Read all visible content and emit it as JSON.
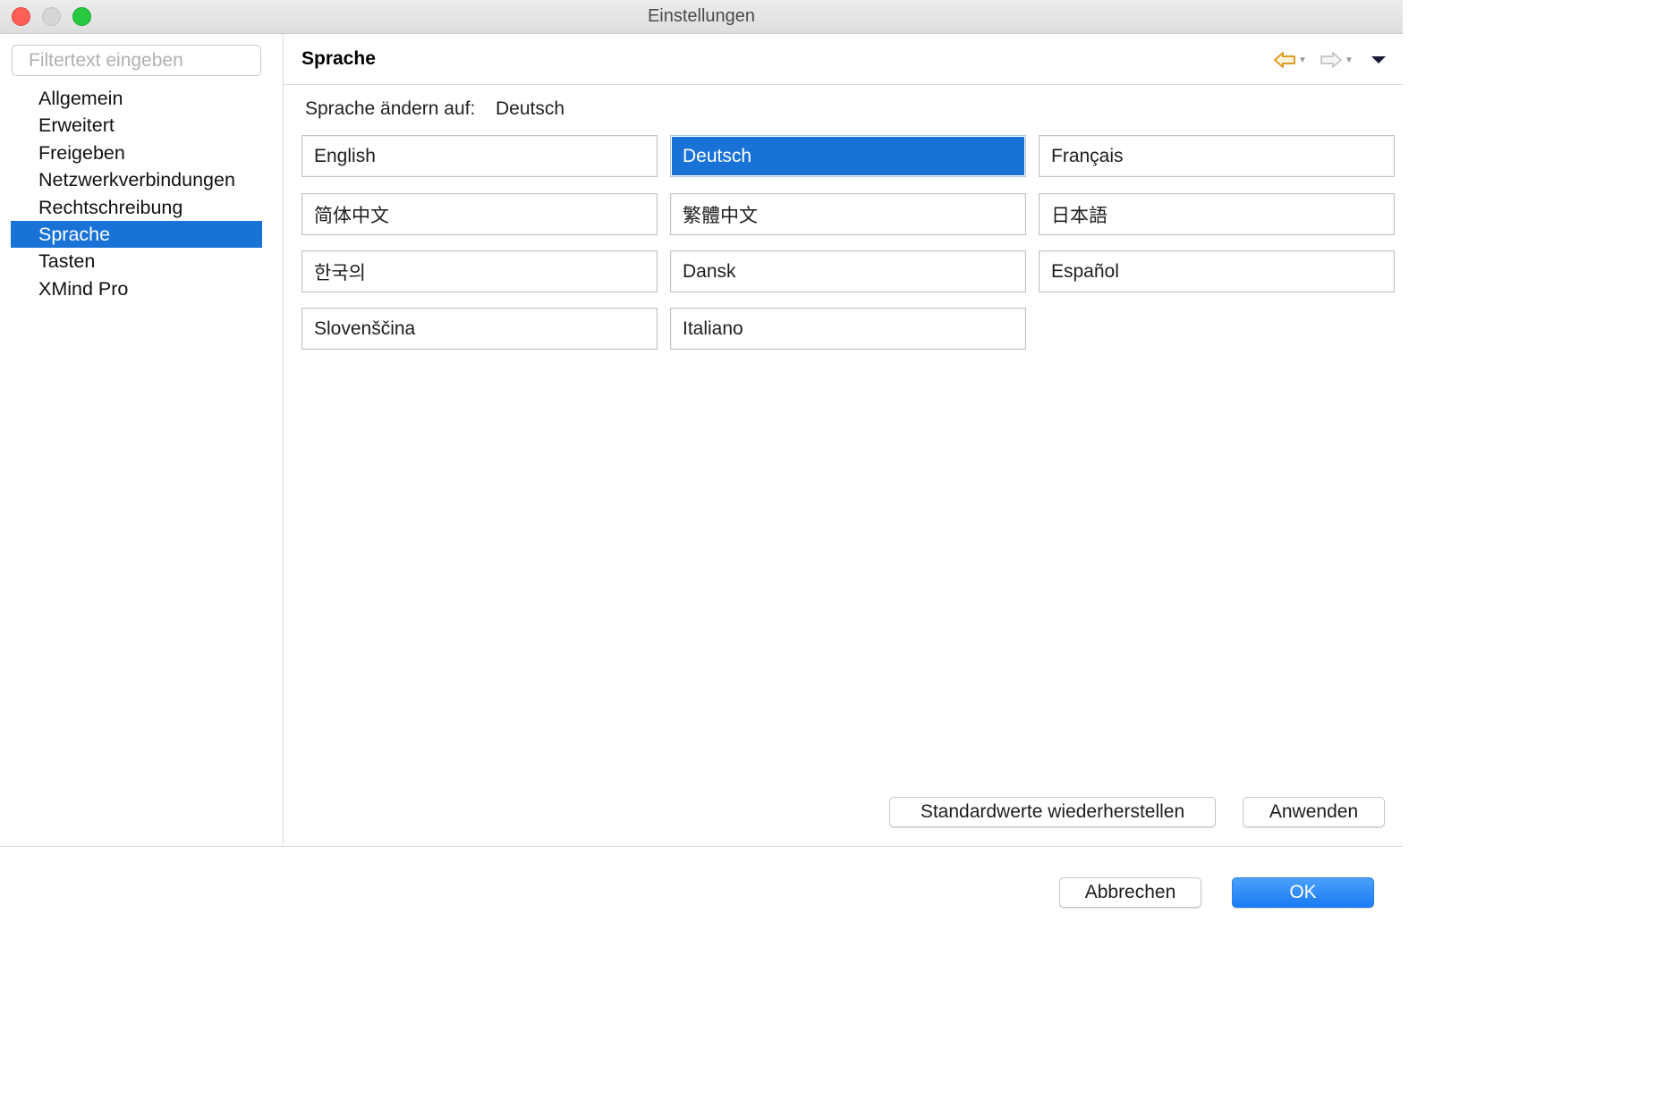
{
  "window": {
    "title": "Einstellungen"
  },
  "sidebar": {
    "filter_placeholder": "Filtertext eingeben",
    "items": [
      {
        "label": "Allgemein"
      },
      {
        "label": "Erweitert"
      },
      {
        "label": "Freigeben"
      },
      {
        "label": "Netzwerkverbindungen"
      },
      {
        "label": "Rechtschreibung"
      },
      {
        "label": "Sprache",
        "selected": true
      },
      {
        "label": "Tasten"
      },
      {
        "label": "XMind Pro"
      }
    ]
  },
  "main": {
    "title": "Sprache",
    "current_language_label": "Sprache ändern auf:",
    "current_language_value": "Deutsch",
    "languages": [
      {
        "label": "English"
      },
      {
        "label": "Deutsch",
        "selected": true
      },
      {
        "label": "Français"
      },
      {
        "label": "简体中文"
      },
      {
        "label": "繁體中文"
      },
      {
        "label": "日本語"
      },
      {
        "label": "한국의"
      },
      {
        "label": "Dansk"
      },
      {
        "label": "Español"
      },
      {
        "label": "Slovenščina"
      },
      {
        "label": "Italiano"
      }
    ],
    "restore_defaults_label": "Standardwerte wiederherstellen",
    "apply_label": "Anwenden",
    "nav_icons": {
      "back": "back-arrow-icon",
      "forward": "forward-arrow-icon",
      "menu": "view-menu-icon"
    }
  },
  "footer": {
    "cancel_label": "Abbrechen",
    "ok_label": "OK"
  },
  "colors": {
    "selection": "#1972d6",
    "ok_button": "#1a7bf3",
    "back_arrow": "#e8a317"
  }
}
